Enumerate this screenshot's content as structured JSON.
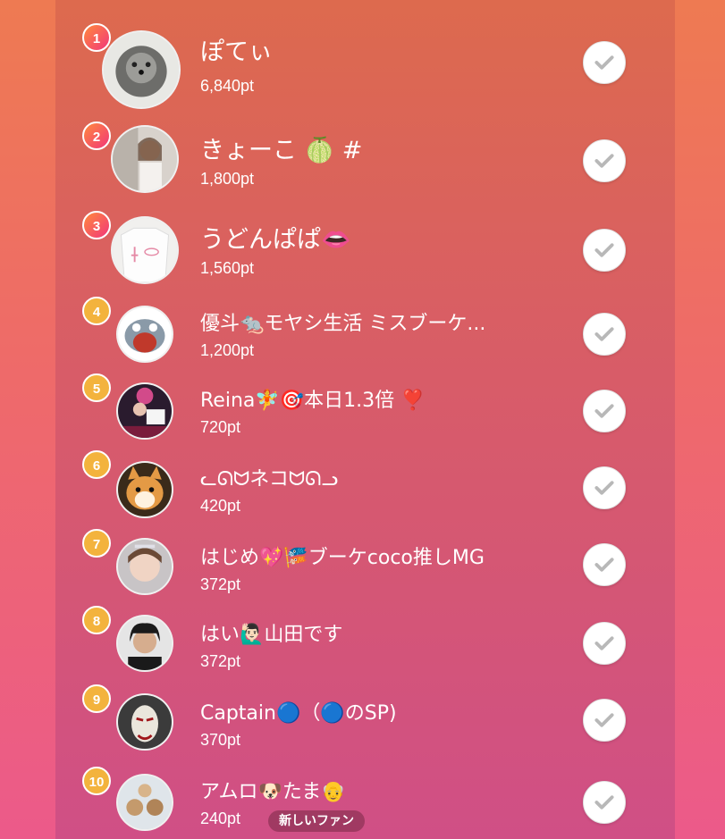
{
  "ranking": [
    {
      "rank": "1",
      "name": "ぽてぃ",
      "points": "6,840pt",
      "avatar": "pomeranian-avatar"
    },
    {
      "rank": "2",
      "name": "きょーこ 🍈 #",
      "points": "1,800pt",
      "avatar": "woman-avatar"
    },
    {
      "rank": "3",
      "name": "うどんぱぱ👄",
      "points": "1,560pt",
      "avatar": "tshirt-avatar"
    },
    {
      "rank": "4",
      "name": "優斗🐀モヤシ生活 ミスブーケ...",
      "points": "1,200pt",
      "avatar": "cartoon-cat-avatar"
    },
    {
      "rank": "5",
      "name": "Reina🧚🎯本日1.3倍 ❣️",
      "points": "720pt",
      "avatar": "event-avatar"
    },
    {
      "rank": "6",
      "name": "ᓚᘏᗢネコᗢᘏᓗ",
      "points": "420pt",
      "avatar": "shiba-avatar"
    },
    {
      "rank": "7",
      "name": "はじめ💖🎏ブーケcoco推しMG",
      "points": "372pt",
      "avatar": "woman-tiara-avatar"
    },
    {
      "rank": "8",
      "name": " はい🙋🏻‍♂️山田です",
      "points": "372pt",
      "avatar": "man-avatar"
    },
    {
      "rank": "9",
      "name": "Captain🔵（🔵のSP)",
      "points": "370pt",
      "avatar": "mask-avatar"
    },
    {
      "rank": "10",
      "name": "アムロ🐶たま👴",
      "points": "240pt",
      "avatar": "dogs-avatar"
    }
  ],
  "new_fan_label": "新しいファン",
  "colors": {
    "top_badge": "#f2367a",
    "regular_badge": "#f3b33d",
    "check": "#b8b8b8"
  }
}
